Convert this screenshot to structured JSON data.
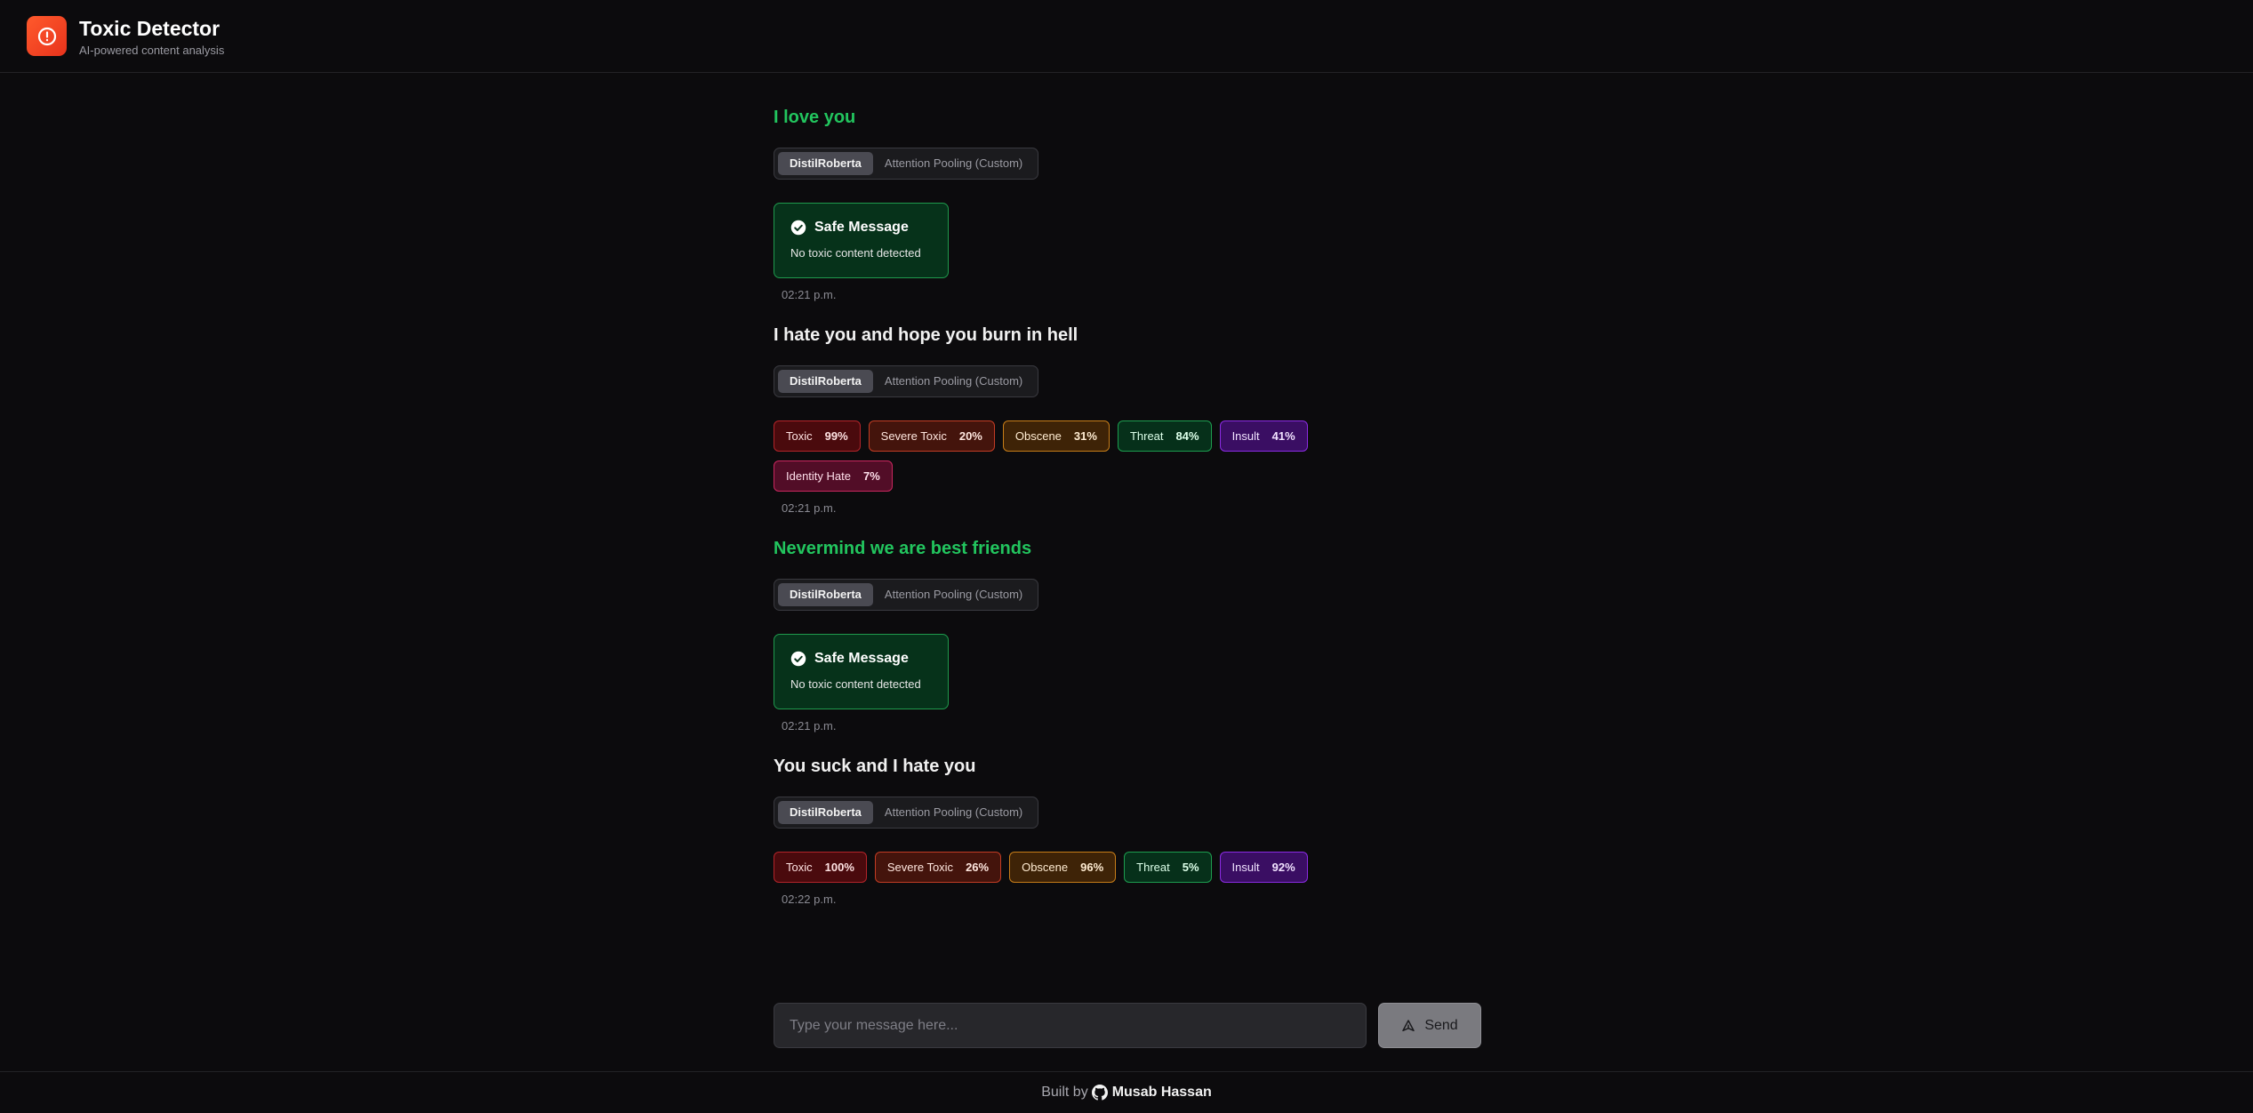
{
  "header": {
    "title": "Toxic Detector",
    "subtitle": "AI-powered content analysis",
    "logo_icon": "alert-circle-icon",
    "logo_color": "#ff4b24"
  },
  "messages": [
    {
      "text": "I love you",
      "status": "safe",
      "models": [
        "DistilRoberta",
        "Attention Pooling (Custom)"
      ],
      "active_model": "DistilRoberta",
      "safe_title": "Safe Message",
      "safe_desc": "No toxic content detected",
      "time": "02:21 p.m."
    },
    {
      "text": "I hate you and hope you burn in hell",
      "status": "toxic",
      "models": [
        "DistilRoberta",
        "Attention Pooling (Custom)"
      ],
      "active_model": "DistilRoberta",
      "labels": [
        {
          "name": "Toxic",
          "pct": "99%",
          "kind": "toxic"
        },
        {
          "name": "Severe Toxic",
          "pct": "20%",
          "kind": "severe"
        },
        {
          "name": "Obscene",
          "pct": "31%",
          "kind": "obscene"
        },
        {
          "name": "Threat",
          "pct": "84%",
          "kind": "threat"
        },
        {
          "name": "Insult",
          "pct": "41%",
          "kind": "insult"
        },
        {
          "name": "Identity Hate",
          "pct": "7%",
          "kind": "identity"
        }
      ],
      "time": "02:21 p.m."
    },
    {
      "text": "Nevermind we are best friends",
      "status": "safe",
      "models": [
        "DistilRoberta",
        "Attention Pooling (Custom)"
      ],
      "active_model": "DistilRoberta",
      "safe_title": "Safe Message",
      "safe_desc": "No toxic content detected",
      "time": "02:21 p.m."
    },
    {
      "text": "You suck and I hate you",
      "status": "toxic",
      "models": [
        "DistilRoberta",
        "Attention Pooling (Custom)"
      ],
      "active_model": "DistilRoberta",
      "labels": [
        {
          "name": "Toxic",
          "pct": "100%",
          "kind": "toxic"
        },
        {
          "name": "Severe Toxic",
          "pct": "26%",
          "kind": "severe"
        },
        {
          "name": "Obscene",
          "pct": "96%",
          "kind": "obscene"
        },
        {
          "name": "Threat",
          "pct": "5%",
          "kind": "threat"
        },
        {
          "name": "Insult",
          "pct": "92%",
          "kind": "insult"
        }
      ],
      "time": "02:22 p.m."
    }
  ],
  "composer": {
    "placeholder": "Type your message here...",
    "send_label": "Send",
    "send_icon": "send-icon"
  },
  "footer": {
    "prefix": "Built by",
    "author": "Musab Hassan",
    "author_icon": "github-icon"
  }
}
